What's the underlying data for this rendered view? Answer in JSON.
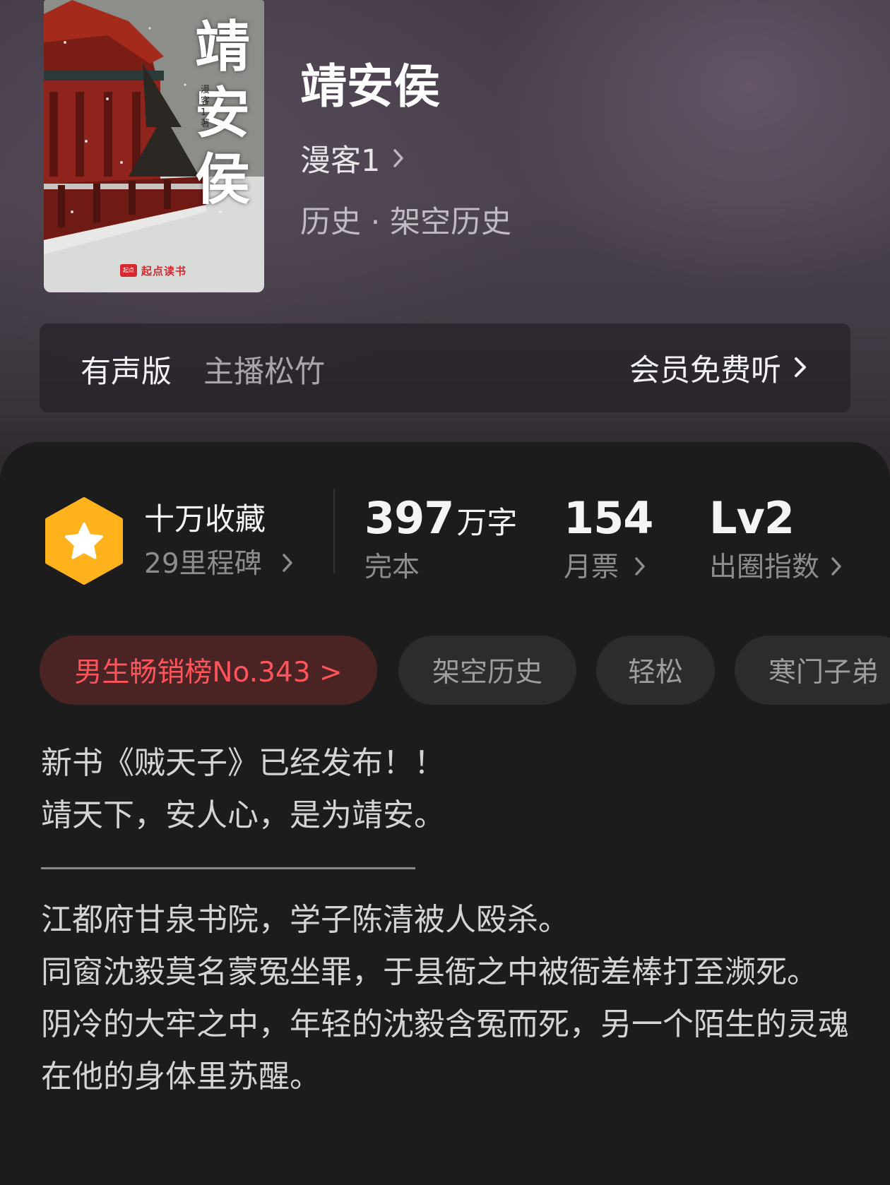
{
  "book": {
    "cover": {
      "title": "靖安侯",
      "author_line": "漫客1 著",
      "publisher_logo": "起点",
      "publisher": "起点读书"
    },
    "title": "靖安侯",
    "author": "漫客1",
    "genre": "历史 · 架空历史"
  },
  "audio": {
    "label": "有声版",
    "host": "主播松竹",
    "cta": "会员免费听"
  },
  "stats": {
    "favorites": {
      "title": "十万收藏",
      "subtitle": "29里程碑",
      "icon": "star-hexagon-icon"
    },
    "words": {
      "value": "397",
      "unit": "万字",
      "label": "完本"
    },
    "monthly_votes": {
      "value": "154",
      "label": "月票"
    },
    "influence": {
      "value": "Lv2",
      "label": "出圈指数"
    }
  },
  "tags": [
    "男生畅销榜No.343 >",
    "架空历史",
    "轻松",
    "寒门子弟"
  ],
  "description": {
    "lines_top": [
      "新书《贼天子》已经发布！！",
      "靖天下，安人心，是为靖安。"
    ],
    "lines_bottom": [
      "江都府甘泉书院，学子陈清被人殴杀。",
      "同窗沈毅莫名蒙冤坐罪，于县衙之中被衙差棒打至濒死。",
      "阴冷的大牢之中，年轻的沈毅含冤而死，另一个陌生的灵魂在他的身体里苏醒。"
    ]
  },
  "colors": {
    "rank_tag_text": "#ff5459",
    "rank_tag_bg": "#4a2325",
    "badge_gold": "#ffb21c",
    "panel_bg": "#1c1c1d"
  }
}
